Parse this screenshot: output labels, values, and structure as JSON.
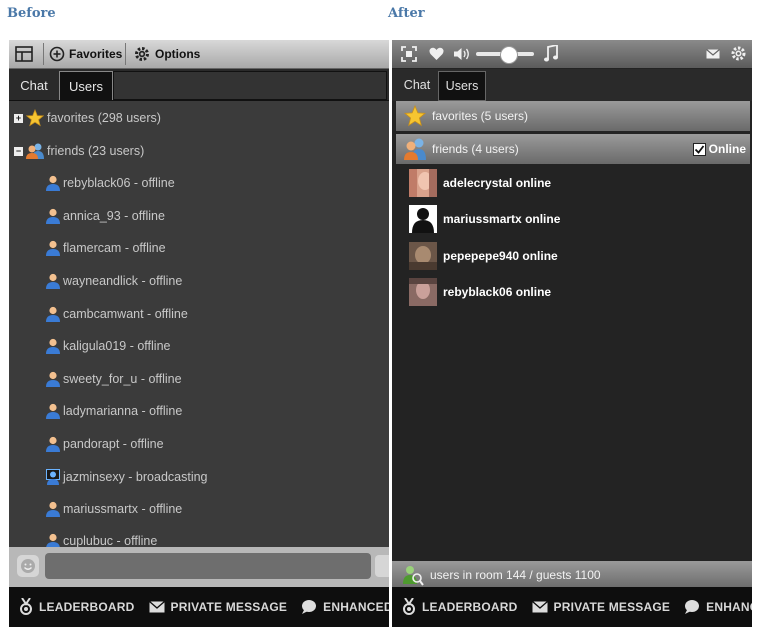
{
  "headings": {
    "before": "Before",
    "after": "After"
  },
  "before": {
    "toolbar": {
      "favorites": "Favorites",
      "options": "Options"
    },
    "tabs": [
      "Chat",
      "Users"
    ],
    "groups": [
      {
        "label": "favorites (298 users)",
        "expander": "+"
      },
      {
        "label": "friends (23 users)",
        "expander": "−"
      }
    ],
    "users": [
      "rebyblack06 - offline",
      "annica_93 - offline",
      "flamercam - offline",
      "wayneandlick - offline",
      "cambcamwant - offline",
      "kaligula019 - offline",
      "sweety_for_u - offline",
      "ladymarianna - offline",
      "pandorapt - offline",
      "jazminsexy - broadcasting",
      "mariussmartx - offline",
      "cuplubuc - offline"
    ]
  },
  "after": {
    "tabs": [
      "Chat",
      "Users"
    ],
    "groups": {
      "favorites": "favorites (5 users)",
      "friends": "friends (4 users)"
    },
    "online_filter": "Online",
    "users": [
      {
        "name": "adelecrystal",
        "status": "online"
      },
      {
        "name": "mariussmartx",
        "status": "online"
      },
      {
        "name": "pepepepe940",
        "status": "online"
      },
      {
        "name": "rebyblack06",
        "status": "online"
      }
    ],
    "room_status": "users in room 144 / guests 1100"
  },
  "footer": {
    "leaderboard": "LEADERBOARD",
    "private_message": "PRIVATE MESSAGE",
    "enhanced_chat": "ENHANCED CHAT"
  },
  "colors": {
    "heading": "#4a78a8",
    "panel_bg": "#3b3b3b",
    "footer_bg": "#0e0e0e"
  }
}
